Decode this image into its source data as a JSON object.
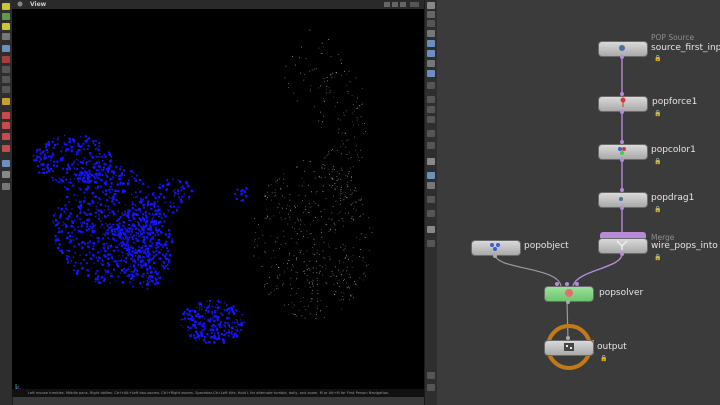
{
  "viewport": {
    "title": "View",
    "status_text": "Left mouse tumbles. Middle pans. Right dollies. Ctrl+Alt+Left box-zooms. Ctrl+Right zooms. Spacebar-Ctrl-Left tilts. Hold L for alternate tumble, dolly, and zoom. M or Alt+M for First Person Navigation."
  },
  "network": {
    "nodes": {
      "source": {
        "type": "POP Source",
        "name": "source_first_inp"
      },
      "force": {
        "name": "popforce1"
      },
      "color": {
        "name": "popcolor1"
      },
      "drag": {
        "name": "popdrag1"
      },
      "merge": {
        "type": "Merge",
        "name": "wire_pops_into"
      },
      "object": {
        "name": "popobject"
      },
      "solver": {
        "name": "popsolver"
      },
      "output": {
        "name": "output"
      }
    }
  },
  "colors": {
    "particles": "#1414ff",
    "solver_node": "#7fd67f",
    "output_ring": "#c07a1a",
    "wire": "#b58ad8"
  }
}
